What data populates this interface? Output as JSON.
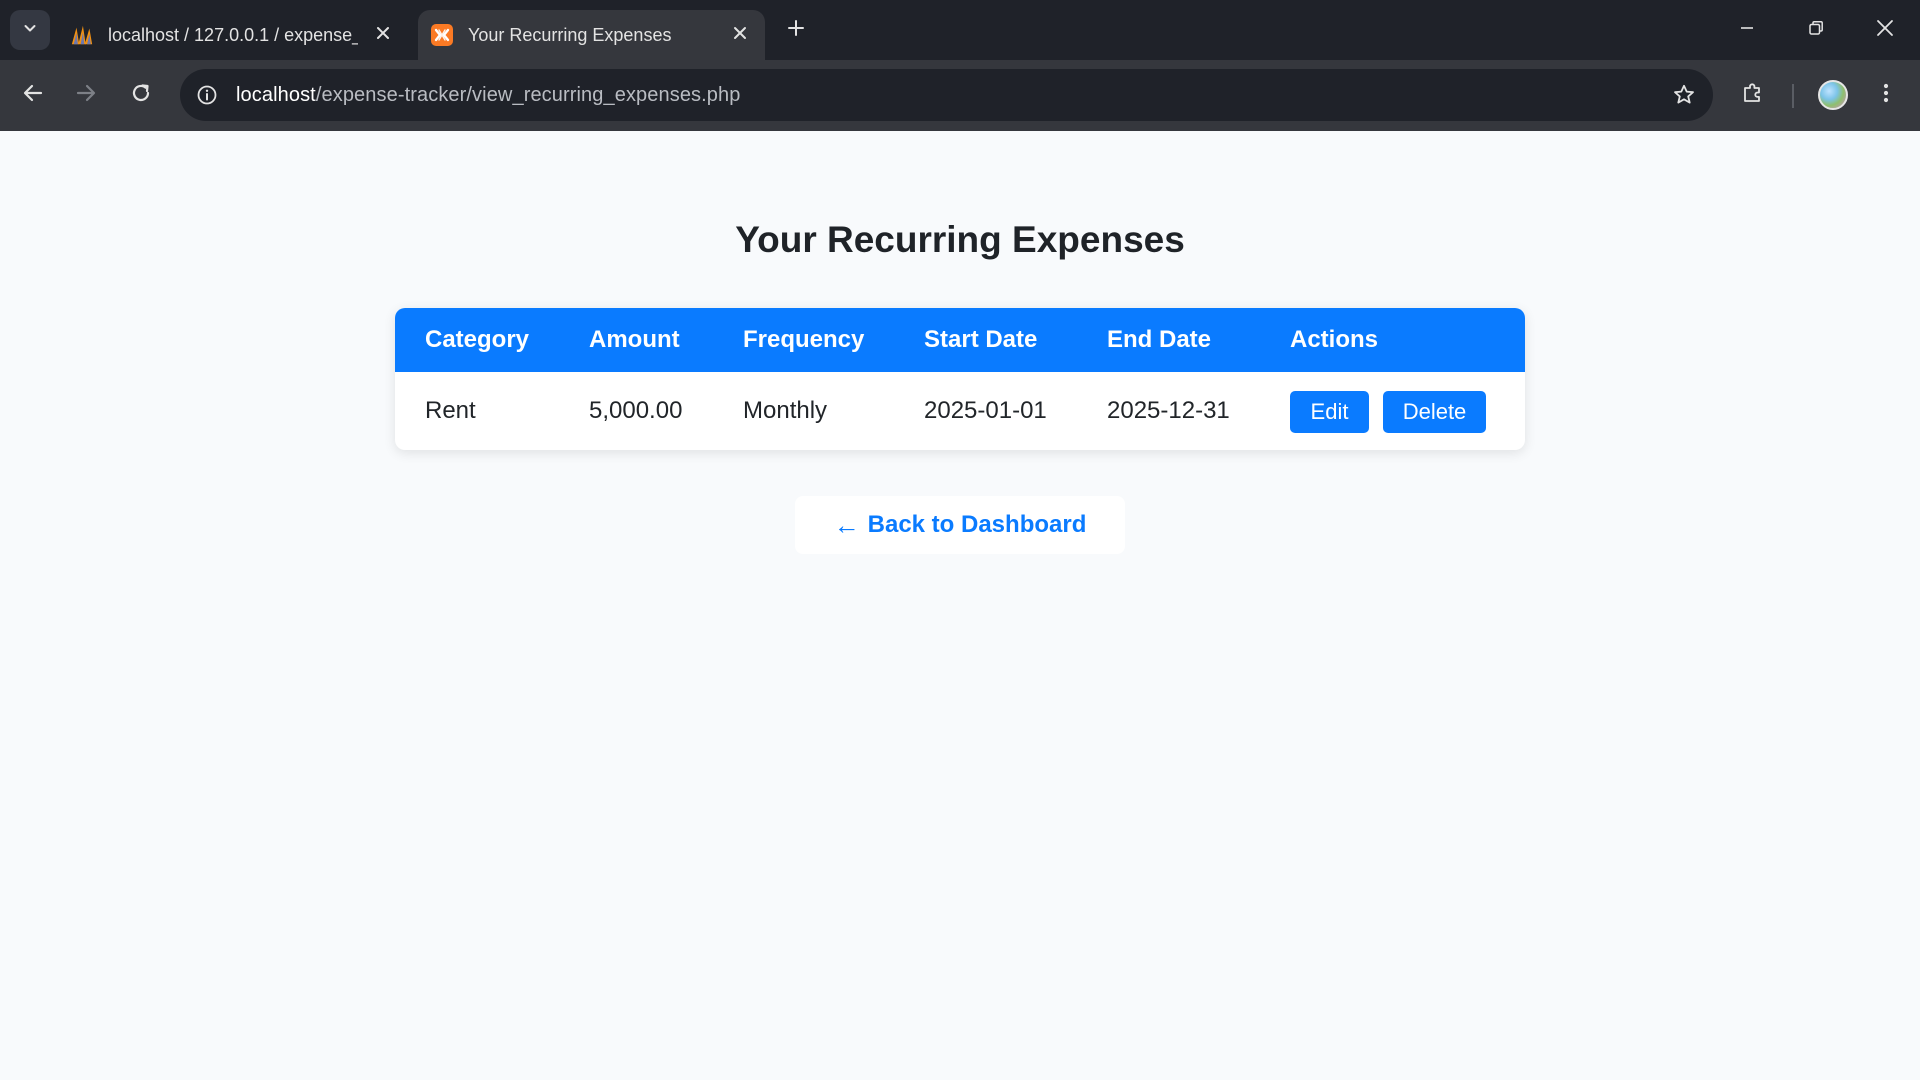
{
  "browser": {
    "tabs": [
      {
        "title": "localhost / 127.0.0.1 / expense_",
        "favicon": "phpmyadmin-icon",
        "active": false
      },
      {
        "title": "Your Recurring Expenses",
        "favicon": "xampp-icon",
        "active": true
      }
    ],
    "url_host": "localhost",
    "url_path": "/expense-tracker/view_recurring_expenses.php"
  },
  "page": {
    "title": "Your Recurring Expenses",
    "table": {
      "headers": [
        "Category",
        "Amount",
        "Frequency",
        "Start Date",
        "End Date",
        "Actions"
      ],
      "rows": [
        {
          "category": "Rent",
          "amount": "5,000.00",
          "frequency": "Monthly",
          "start_date": "2025-01-01",
          "end_date": "2025-12-31",
          "edit_label": "Edit",
          "delete_label": "Delete"
        }
      ]
    },
    "back_link": {
      "arrow": "←",
      "label": "Back to Dashboard"
    }
  },
  "colors": {
    "accent": "#0a7bff",
    "page_bg": "#f8fafc",
    "chrome_dark": "#1f2229",
    "chrome_mid": "#35373d"
  }
}
